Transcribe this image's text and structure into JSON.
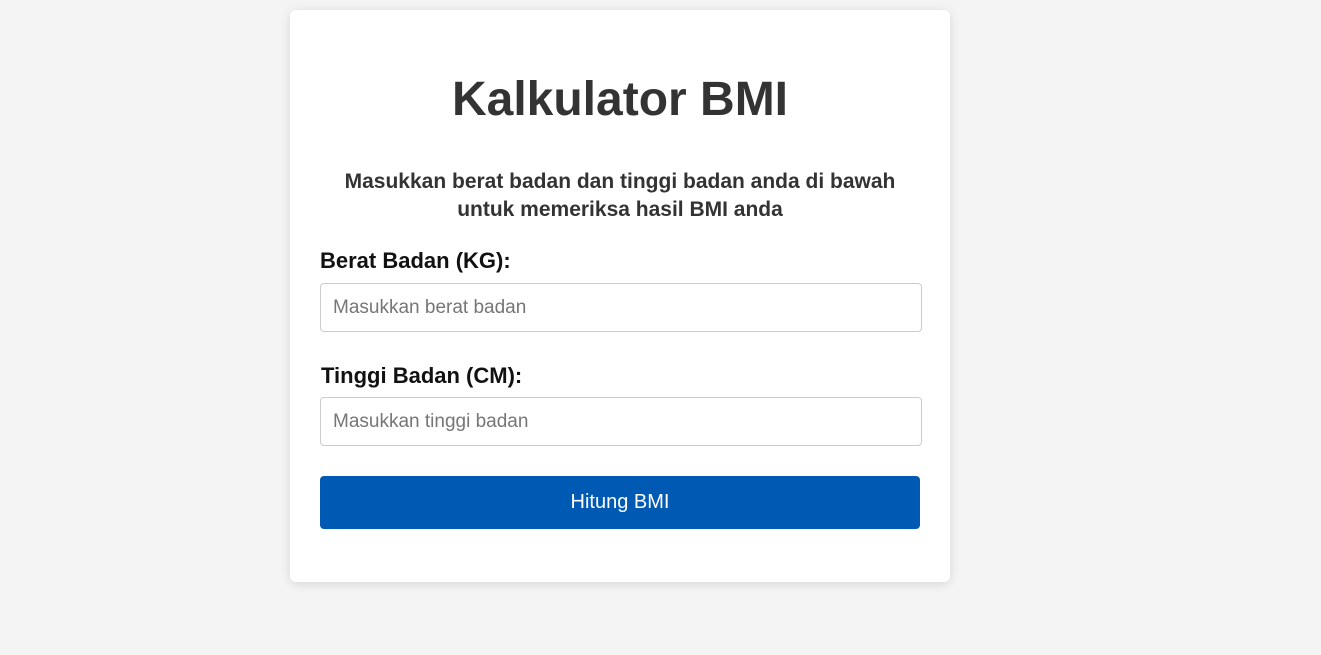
{
  "calculator": {
    "title": "Kalkulator BMI",
    "subtitle": "Masukkan berat badan dan tinggi badan anda di bawah untuk memeriksa hasil BMI anda",
    "weight": {
      "label": "Berat Badan (KG):",
      "value": "",
      "placeholder": "Masukkan berat badan"
    },
    "height": {
      "label": "Tinggi Badan (CM):",
      "value": "",
      "placeholder": "Masukkan tinggi badan"
    },
    "submit_label": "Hitung BMI"
  },
  "colors": {
    "background": "#f4f4f4",
    "card": "#ffffff",
    "button": "#0059b3",
    "button_text": "#ffffff",
    "heading": "#333333"
  }
}
